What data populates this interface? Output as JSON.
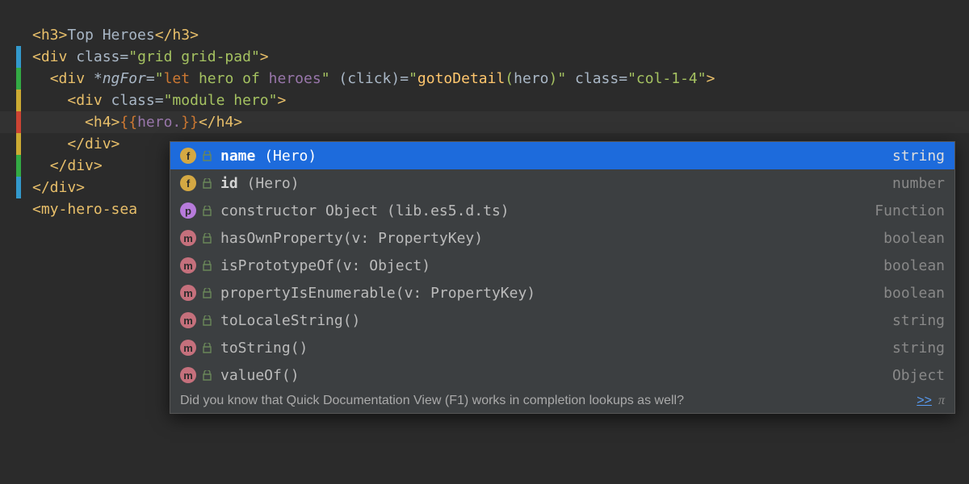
{
  "code": {
    "l1_h3_text": "Top Heroes",
    "l2_div_class": "grid grid-pad",
    "l3_ngfor": "let",
    "l3_ngfor_mid": " hero of ",
    "l3_ngfor_var": "heroes",
    "l3_click_func": "gotoDetail",
    "l3_click_arg": "hero",
    "l3_class": "col-1-4",
    "l4_class": "module hero",
    "l5_interp": "hero.",
    "l9_tag": "my-hero-sea"
  },
  "popup": {
    "items": [
      {
        "badge": "f",
        "name": "name",
        "detail": " (Hero)",
        "type": "string",
        "selected": true
      },
      {
        "badge": "f",
        "name": "id",
        "detail": " (Hero)",
        "type": "number",
        "selected": false
      },
      {
        "badge": "p",
        "name": "constructor",
        "detail": " Object (lib.es5.d.ts)",
        "type": "Function",
        "selected": false,
        "nobold": true
      },
      {
        "badge": "m",
        "name": "hasOwnProperty(v: PropertyKey)",
        "detail": "",
        "type": "boolean",
        "selected": false,
        "nobold": true
      },
      {
        "badge": "m",
        "name": "isPrototypeOf(v: Object)",
        "detail": "",
        "type": "boolean",
        "selected": false,
        "nobold": true
      },
      {
        "badge": "m",
        "name": "propertyIsEnumerable(v: PropertyKey)",
        "detail": "",
        "type": "boolean",
        "selected": false,
        "nobold": true
      },
      {
        "badge": "m",
        "name": "toLocaleString()",
        "detail": "",
        "type": "string",
        "selected": false,
        "nobold": true
      },
      {
        "badge": "m",
        "name": "toString()",
        "detail": "",
        "type": "string",
        "selected": false,
        "nobold": true
      },
      {
        "badge": "m",
        "name": "valueOf()",
        "detail": "",
        "type": "Object",
        "selected": false,
        "nobold": true
      }
    ],
    "footer_text": "Did you know that Quick Documentation View (F1) works in completion lookups as well?",
    "footer_link": ">>",
    "footer_pi": "π"
  }
}
